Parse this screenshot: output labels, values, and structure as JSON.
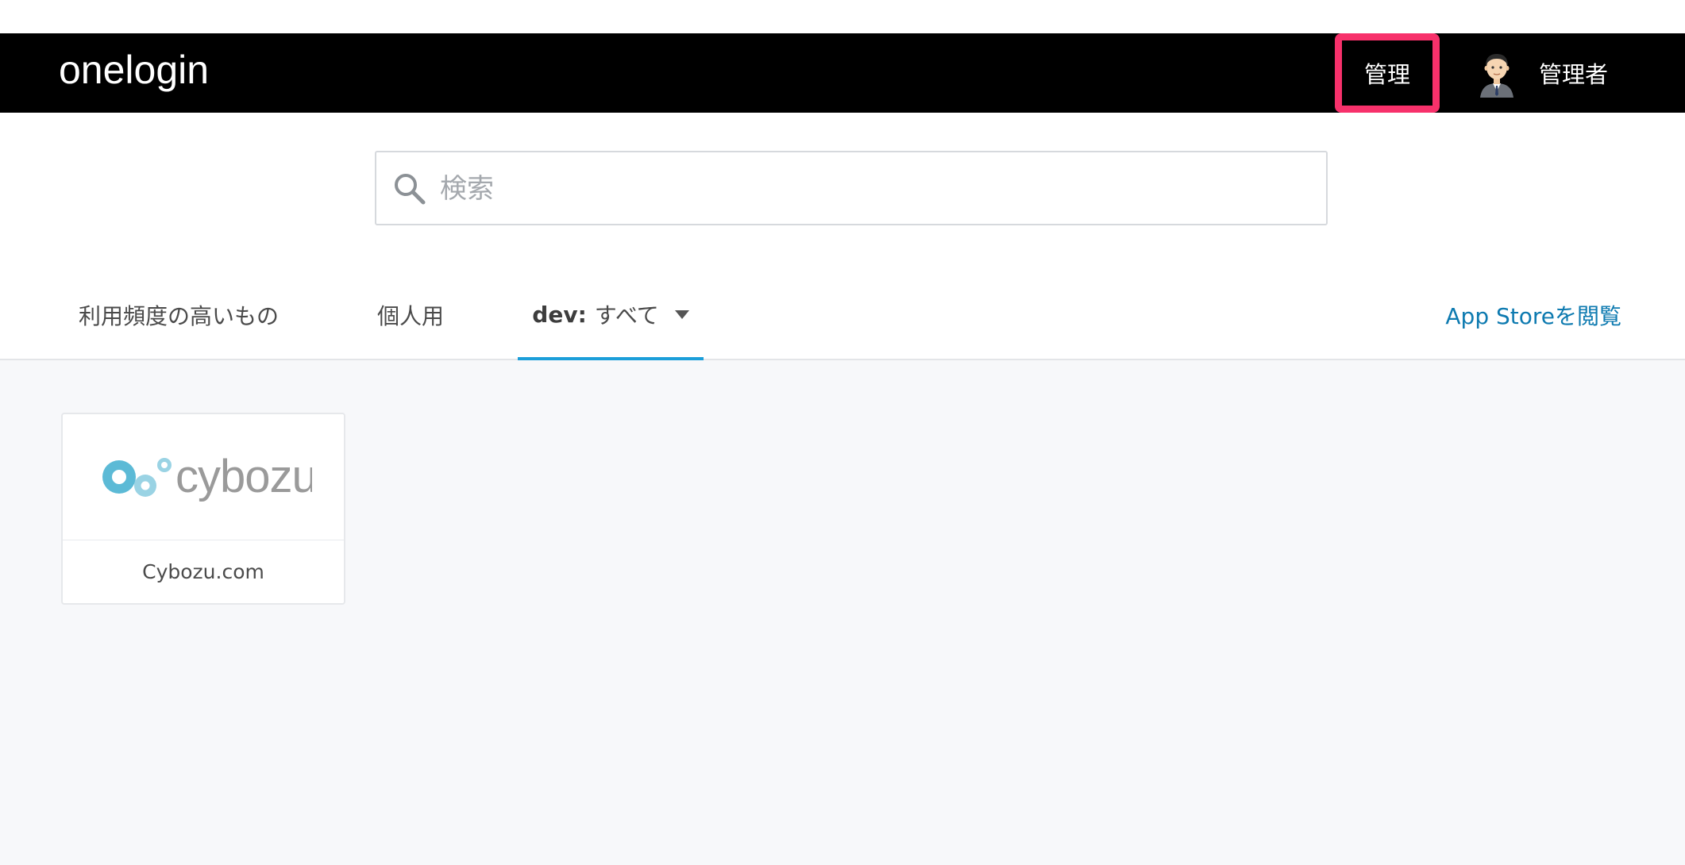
{
  "header": {
    "logo_text": "onelogin",
    "admin_button_label": "管理",
    "admin_highlight_color": "#f7316b",
    "user_name": "管理者",
    "avatar_icon": "user-avatar-icon"
  },
  "search": {
    "placeholder": "検索",
    "value": "",
    "icon": "search-icon"
  },
  "tabs": [
    {
      "label": "利用頻度の高いもの",
      "active": false
    },
    {
      "label": "個人用",
      "active": false
    },
    {
      "prefix": "dev",
      "separator": ":",
      "label": "すべて",
      "active": true,
      "dropdown_icon": "caret-down-icon"
    }
  ],
  "app_store_link": "App Storeを閲覧",
  "accent_color": "#1b9ed9",
  "apps": [
    {
      "name": "Cybozu.com",
      "logo_text": "cybozu"
    }
  ]
}
